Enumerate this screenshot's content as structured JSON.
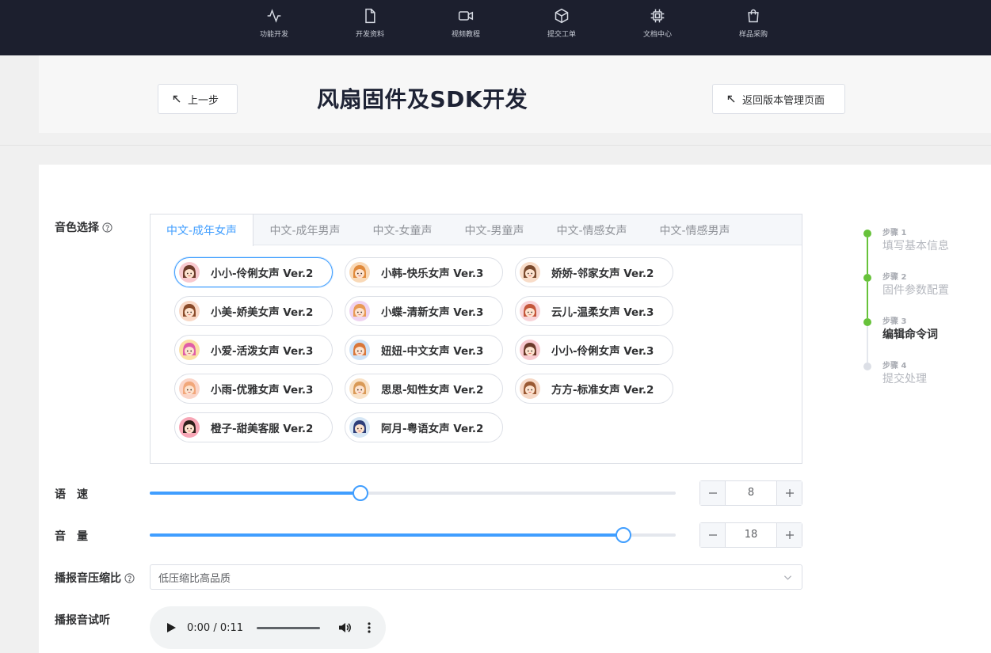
{
  "nav": [
    {
      "label": "功能开发",
      "icon": "activity-icon"
    },
    {
      "label": "开发资料",
      "icon": "file-icon"
    },
    {
      "label": "视频教程",
      "icon": "video-icon"
    },
    {
      "label": "提交工单",
      "icon": "box-icon"
    },
    {
      "label": "文档中心",
      "icon": "chip-icon"
    },
    {
      "label": "样品采购",
      "icon": "shopping-bag-icon"
    }
  ],
  "header": {
    "back_label": "上一步",
    "title": "风扇固件及SDK开发",
    "version_label": "返回版本管理页面"
  },
  "form": {
    "voice_label": "音色选择",
    "speed_label": "语　速",
    "volume_label": "音　量",
    "compression_label": "播报音压缩比",
    "preview_label": "播报音试听"
  },
  "tabs": [
    {
      "label": "中文-成年女声",
      "active": true
    },
    {
      "label": "中文-成年男声",
      "active": false
    },
    {
      "label": "中文-女童声",
      "active": false
    },
    {
      "label": "中文-男童声",
      "active": false
    },
    {
      "label": "中文-情感女声",
      "active": false
    },
    {
      "label": "中文-情感男声",
      "active": false
    }
  ],
  "voices": [
    {
      "name": "小小-伶俐女声 Ver.2",
      "selected": true,
      "hair": "#6b3a2a",
      "bg": "#f8c9cf"
    },
    {
      "name": "小韩-快乐女声 Ver.3",
      "selected": false,
      "hair": "#e08a3c",
      "bg": "#f9d9b7"
    },
    {
      "name": "娇娇-邻家女声 Ver.2",
      "selected": false,
      "hair": "#7a4a2e",
      "bg": "#f8dcc8"
    },
    {
      "name": "小美-娇美女声 Ver.2",
      "selected": false,
      "hair": "#8a4b2a",
      "bg": "#f9d8c6"
    },
    {
      "name": "小蝶-清新女声 Ver.3",
      "selected": false,
      "hair": "#e89a55",
      "bg": "#efd3f0"
    },
    {
      "name": "云儿-温柔女声 Ver.3",
      "selected": false,
      "hair": "#c4573b",
      "bg": "#f8d3d8"
    },
    {
      "name": "小爱-活泼女声 Ver.3",
      "selected": false,
      "hair": "#e05ea8",
      "bg": "#fbe0a5"
    },
    {
      "name": "妞妞-中文女声 Ver.3",
      "selected": false,
      "hair": "#d9773a",
      "bg": "#cfe2f6"
    },
    {
      "name": "小小-伶俐女声 Ver.3",
      "selected": false,
      "hair": "#6b3a2a",
      "bg": "#f8c9cf"
    },
    {
      "name": "小雨-优雅女声 Ver.3",
      "selected": false,
      "hair": "#f1a77a",
      "bg": "#fbd5c8"
    },
    {
      "name": "思思-知性女声 Ver.2",
      "selected": false,
      "hair": "#d99a57",
      "bg": "#f9e2c7"
    },
    {
      "name": "方方-标准女声 Ver.2",
      "selected": false,
      "hair": "#9a5a34",
      "bg": "#f6d8c6"
    },
    {
      "name": "橙子-甜美客服 Ver.2",
      "selected": false,
      "hair": "#2e1f1a",
      "bg": "#f7a6b6"
    },
    {
      "name": "阿月-粤语女声 Ver.2",
      "selected": false,
      "hair": "#2f3f7a",
      "bg": "#d6e6f5"
    }
  ],
  "speed": {
    "value": "8",
    "min": 0,
    "max": 20
  },
  "volume": {
    "value": "18",
    "min": 0,
    "max": 20
  },
  "compression": {
    "value": "低压缩比高品质"
  },
  "audio": {
    "time": "0:00 / 0:11"
  },
  "steps": [
    {
      "num": "步骤 1",
      "title": "填写基本信息",
      "status": "done"
    },
    {
      "num": "步骤 2",
      "title": "固件参数配置",
      "status": "done"
    },
    {
      "num": "步骤 3",
      "title": "编辑命令词",
      "status": "current"
    },
    {
      "num": "步骤 4",
      "title": "提交处理",
      "status": "pending"
    }
  ],
  "colors": {
    "primary": "#409eff",
    "success": "#67c23a",
    "nav_bg": "#1c1f2e"
  }
}
